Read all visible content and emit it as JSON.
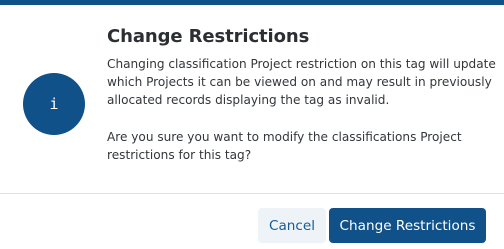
{
  "dialog": {
    "title": "Change Restrictions",
    "message_lines_1": [
      "Changing classification Project restriction on this tag will update",
      "which Projects it can be viewed on and may result in previously",
      "allocated records displaying the tag as invalid."
    ],
    "message_lines_2": [
      "Are you sure you want to modify the classifications Project",
      "restrictions for this tag?"
    ],
    "icon": "info-icon",
    "icon_glyph": "i"
  },
  "actions": {
    "cancel_label": "Cancel",
    "confirm_label": "Change Restrictions"
  },
  "colors": {
    "accent": "#0f5188",
    "cancel_bg": "#eef3f8",
    "cancel_text": "#1a5a96",
    "title_text": "#2b2f33",
    "body_text": "#33373b"
  }
}
